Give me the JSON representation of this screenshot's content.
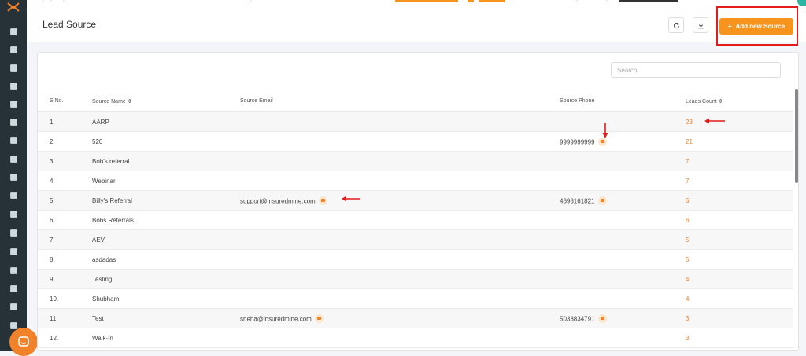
{
  "header": {
    "title": "Lead Source",
    "add_button_label": "Add new Source",
    "refresh_icon": "refresh-icon",
    "download_icon": "download-icon"
  },
  "search": {
    "placeholder": "Search"
  },
  "table": {
    "columns": [
      "S.No.",
      "Source Name",
      "Source Email",
      "Source Phone",
      "Leads Count"
    ],
    "rows": [
      {
        "sno": "1.",
        "name": "AARP",
        "email": "",
        "phone": "",
        "count": "23"
      },
      {
        "sno": "2.",
        "name": "520",
        "email": "",
        "phone": "9999999999",
        "count": "21"
      },
      {
        "sno": "3.",
        "name": "Bob's referral",
        "email": "",
        "phone": "",
        "count": "7"
      },
      {
        "sno": "4.",
        "name": "Webinar",
        "email": "",
        "phone": "",
        "count": "7"
      },
      {
        "sno": "5.",
        "name": "Billy's Referral",
        "email": "support@insuredmine.com",
        "phone": "4696161821",
        "count": "6"
      },
      {
        "sno": "6.",
        "name": "Bobs Referrals",
        "email": "",
        "phone": "",
        "count": "6"
      },
      {
        "sno": "7.",
        "name": "AEV",
        "email": "",
        "phone": "",
        "count": "5"
      },
      {
        "sno": "8.",
        "name": "asdadas",
        "email": "",
        "phone": "",
        "count": "5"
      },
      {
        "sno": "9.",
        "name": "Testing",
        "email": "",
        "phone": "",
        "count": "4"
      },
      {
        "sno": "10.",
        "name": "Shubham",
        "email": "",
        "phone": "",
        "count": "4"
      },
      {
        "sno": "11.",
        "name": "Test",
        "email": "sneha@insuredmine.com",
        "phone": "5033834791",
        "count": "3"
      },
      {
        "sno": "12.",
        "name": "Walk-In",
        "email": "",
        "phone": "",
        "count": "3"
      }
    ]
  },
  "colors": {
    "accent": "#f7941d",
    "sidebar": "#263238",
    "annotation": "#e21b1b"
  },
  "sidebar_icons": [
    "dashboard-icon",
    "contacts-icon",
    "copy-icon",
    "bank-icon",
    "list-icon",
    "document-icon",
    "filter-icon",
    "megaphone-icon",
    "table-icon",
    "chart-icon",
    "mail-icon",
    "calculator-icon",
    "calendar-icon",
    "inbox-icon",
    "dollar-icon",
    "clipboard-icon",
    "gear-icon"
  ]
}
